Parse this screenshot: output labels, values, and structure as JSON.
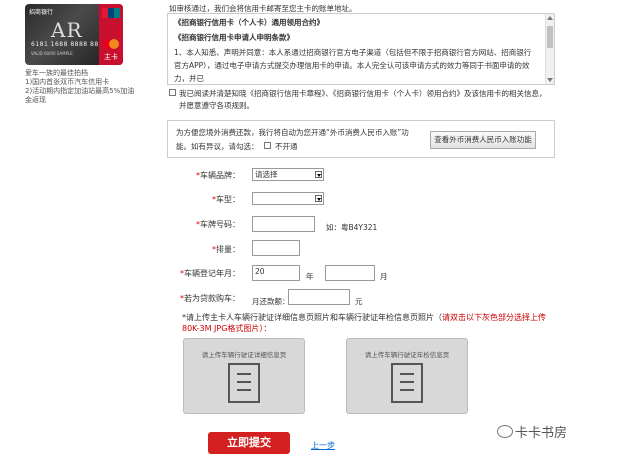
{
  "promo": {
    "card_bank": "招商银行",
    "card_brand": "AR",
    "card_number": "6181 1688 8888 8888",
    "card_small": "VALID 00/00  SAMPLE",
    "card_badge": "主卡",
    "line1": "爱车一族的最佳拍档",
    "line2": "1)国内首张双币汽车信用卡",
    "line3": "2)活动期内指定加油站最高5%加油金返现"
  },
  "top_note": "如审核通过，我们会将信用卡邮寄至您主卡的账单地址。",
  "agreement": {
    "title1": "《招商银行信用卡（个人卡）通用领用合约》",
    "title2": "《招商银行信用卡申请人申明条款》",
    "body": "1、本人知悉、声明并同意：本人系通过招商银行官方电子渠道（包括但不限于招商银行官方网站、招商银行官方APP），通过电子申请方式提交办理信用卡的申请。本人完全认可该申请方式的效力等同于书面申请的效力，并已"
  },
  "consent": {
    "line1": "我已阅读并清楚知晓《招商银行信用卡章程》、《招商银行信用卡（个人卡）领用合约》及该信用卡的相关信息，",
    "line2": "并愿意遵守各项规则。"
  },
  "foreign_exchange": {
    "line1": "为方便您境外消费还款，我行将自动为您开通“外币消费人民币入账”功",
    "line2": "能。如有异议，请勾选：",
    "no_open_label": "不开通",
    "button_label": "查看外币消费人民币入账功能"
  },
  "form": {
    "brand_label": "车辆品牌：",
    "brand_value": "请选择",
    "model_label": "车型：",
    "model_value": "",
    "plate_label": "车牌号码：",
    "plate_hint": "如：粤B4Y321",
    "displacement_label": "排量：",
    "reg_label": "车辆登记年月：",
    "reg_year": "20",
    "year_unit": "年",
    "month_unit": "月",
    "loan_label": "若为贷款购车：",
    "loan_sub": "月还款额：",
    "loan_unit": "元",
    "star": "*"
  },
  "upload": {
    "note_plain": "*请上传主卡人车辆行驶证详细信息页照片和车辆行驶证年检信息页照片（",
    "note_red": "请双击以下灰色部分选择上传80K-3M JPG格式图片）：",
    "box1": "请上传车辆行驶证详细信息页",
    "box2": "请上传车辆行驶证年检信息页"
  },
  "actions": {
    "submit": "立即提交",
    "prev": "上一步"
  },
  "watermark": "卡卡书房",
  "colors": {
    "accent_red": "#d42020",
    "link_blue": "#0066cc"
  }
}
